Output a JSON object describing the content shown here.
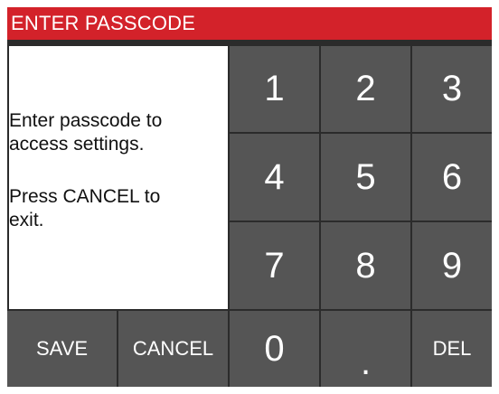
{
  "title": "ENTER PASSCODE",
  "message": {
    "line1": "Enter passcode to",
    "line2": "access settings.",
    "line3": "Press CANCEL to",
    "line4": "exit."
  },
  "keypad": {
    "k1": "1",
    "k2": "2",
    "k3": "3",
    "k4": "4",
    "k5": "5",
    "k6": "6",
    "k7": "7",
    "k8": "8",
    "k9": "9",
    "k0": "0",
    "dot": ".",
    "del": "DEL"
  },
  "actions": {
    "save": "SAVE",
    "cancel": "CANCEL"
  },
  "colors": {
    "titlebar": "#d3222a",
    "key": "#555555",
    "border": "#2b2b2b",
    "message_bg": "#ffffff"
  }
}
